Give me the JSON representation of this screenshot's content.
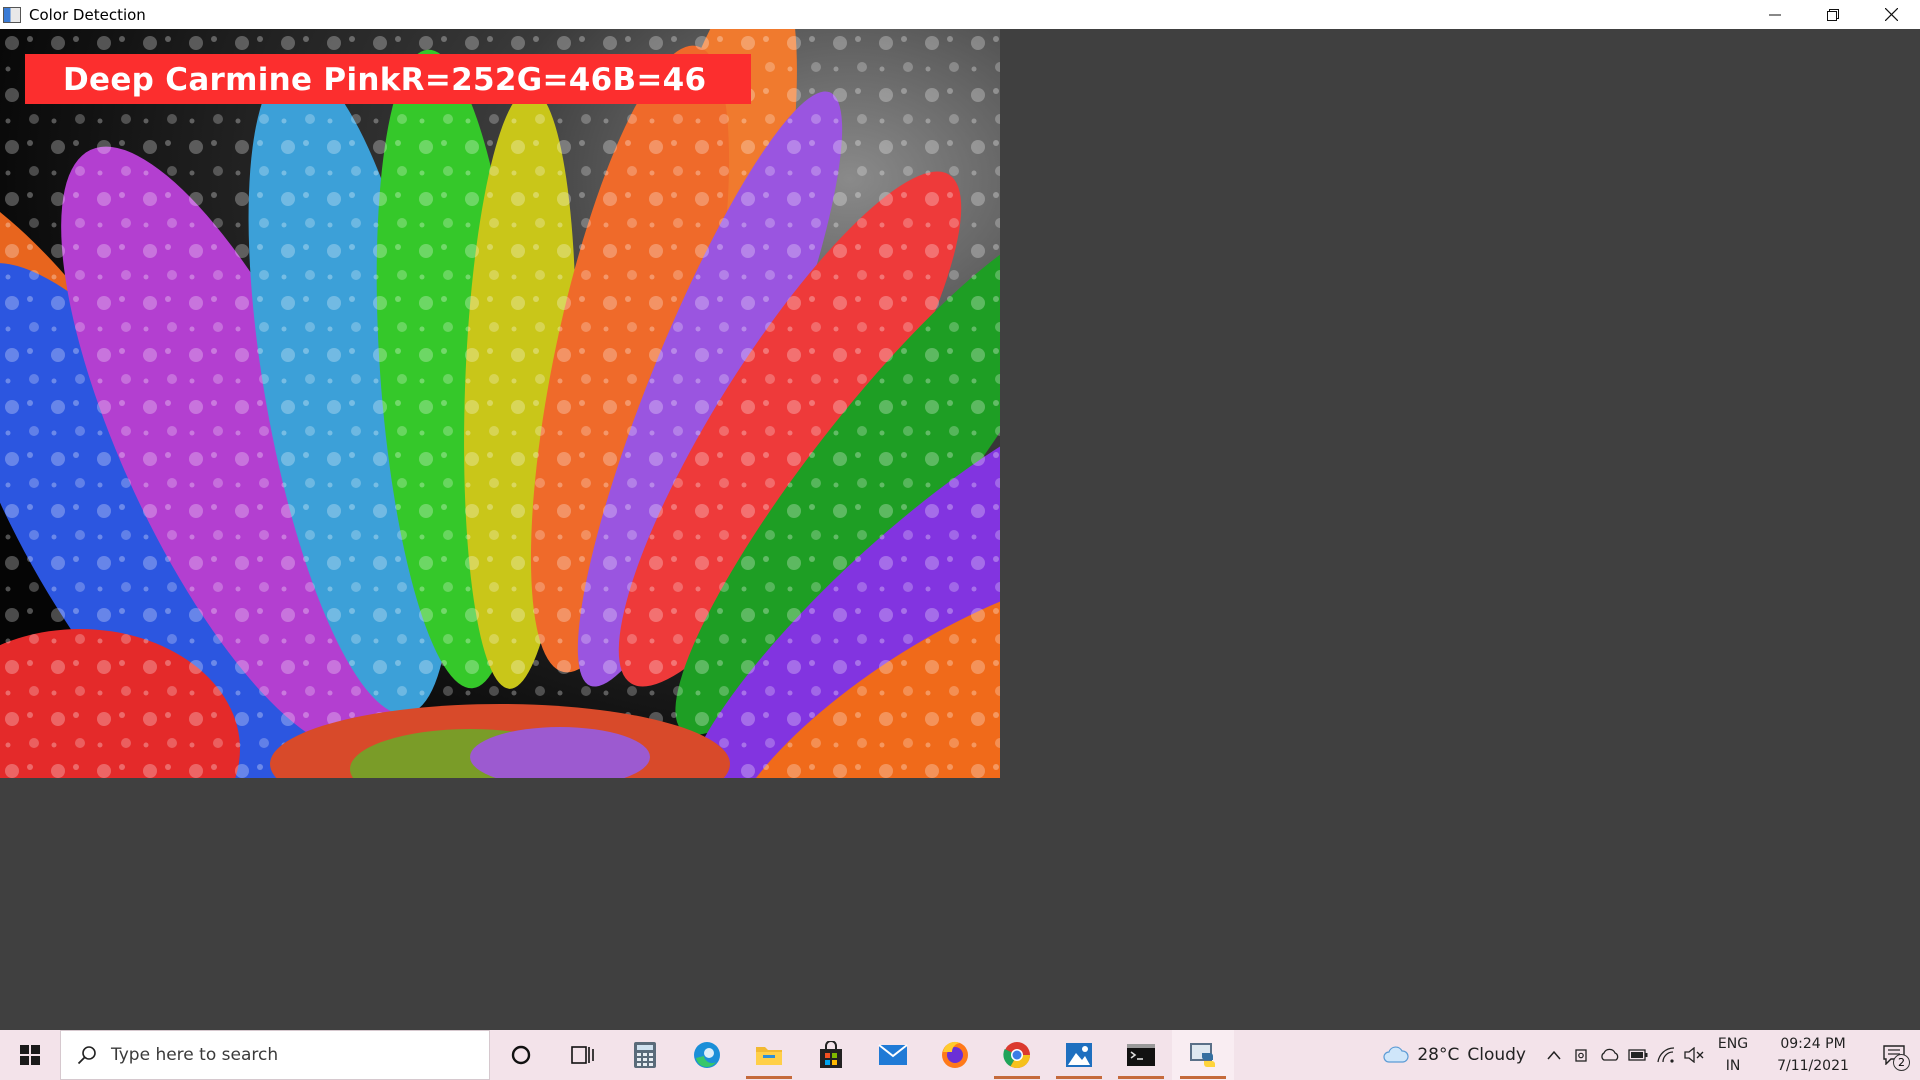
{
  "window": {
    "title": "Color Detection",
    "minimize_icon": "minimize-icon",
    "restore_icon": "restore-icon",
    "close_icon": "close-icon"
  },
  "image": {
    "description_icon": "flower-petals-image",
    "overlay": {
      "text": "Deep Carmine PinkR=252G=46B=46",
      "box_color": "#fc2e2e",
      "text_color": "#ffffff"
    }
  },
  "taskbar": {
    "search_placeholder": "Type here to search",
    "pinned": [
      "cortana-icon",
      "task-view-icon",
      "calculator-icon",
      "edge-icon",
      "file-explorer-icon",
      "store-icon",
      "mail-icon",
      "firefox-icon",
      "chrome-icon",
      "photos-icon",
      "terminal-icon",
      "python-icon"
    ],
    "weather": {
      "temp": "28°C",
      "condition": "Cloudy"
    },
    "language": {
      "line1": "ENG",
      "line2": "IN"
    },
    "clock": {
      "time": "09:24 PM",
      "date": "7/11/2021"
    },
    "notifications": {
      "count": "2"
    }
  }
}
